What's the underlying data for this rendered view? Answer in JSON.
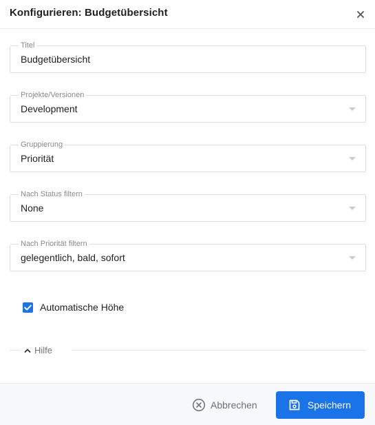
{
  "dialog": {
    "title": "Konfigurieren: Budgetübersicht",
    "close_icon": "close-icon"
  },
  "fields": {
    "title": {
      "label": "Titel",
      "value": "Budgetübersicht"
    },
    "projects": {
      "label": "Projekte/Versionen",
      "value": "Development"
    },
    "grouping": {
      "label": "Gruppierung",
      "value": "Priorität"
    },
    "status_filter": {
      "label": "Nach Status filtern",
      "value": "None"
    },
    "priority_filter": {
      "label": "Nach Priorität filtern",
      "value": "gelegentlich, bald, sofort"
    }
  },
  "auto_height": {
    "label": "Automatische Höhe",
    "checked": true
  },
  "help": {
    "label": "Hilfe",
    "expanded": false
  },
  "footer": {
    "cancel_label": "Abbrechen",
    "save_label": "Speichern"
  },
  "colors": {
    "accent": "#1a73e8",
    "footer_background": "#f7f8fa",
    "border": "#dcdcdc"
  }
}
